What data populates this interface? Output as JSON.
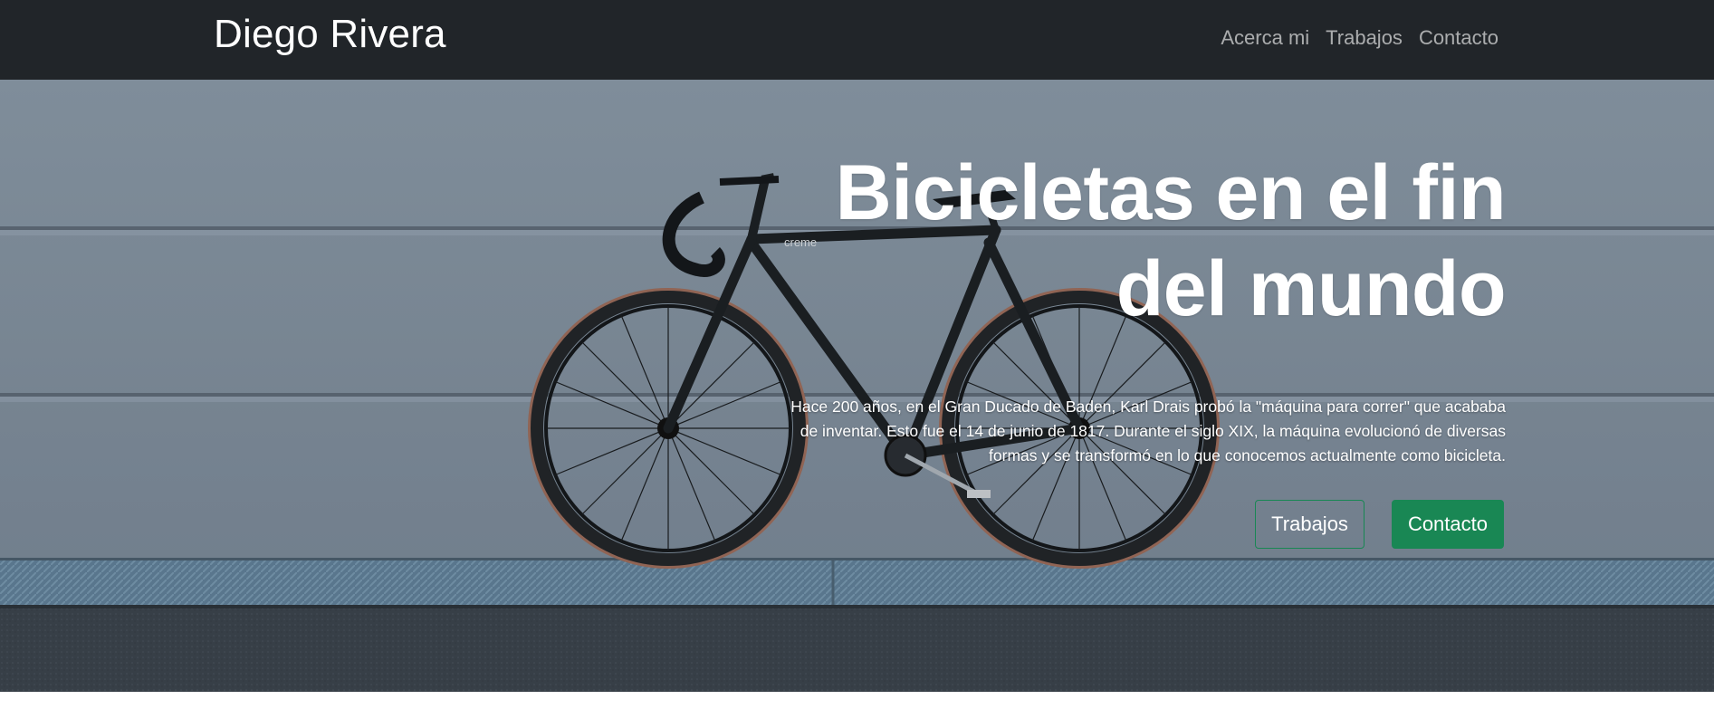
{
  "navbar": {
    "brand": "Diego Rivera",
    "links": [
      "Acerca mi",
      "Trabajos",
      "Contacto"
    ]
  },
  "hero": {
    "title_line1": "Bicicletas en el fin",
    "title_line2": "del mundo",
    "description_line1": "Hace 200 años, en el Gran Ducado de Baden, Karl Drais probó la \"máquina para correr\" que acababa",
    "description_line2": "de inventar. Esto fue el 14 de junio de 1817. Durante el siglo XIX, la máquina evolucionó de diversas",
    "description_line3": "formas y se transformó en lo que conocemos actualmente como bicicleta.",
    "bike_brand": "creme",
    "buttons": {
      "secondary": "Trabajos",
      "primary": "Contacto"
    }
  },
  "colors": {
    "navbar_bg": "#212529",
    "accent_green": "#198754"
  }
}
